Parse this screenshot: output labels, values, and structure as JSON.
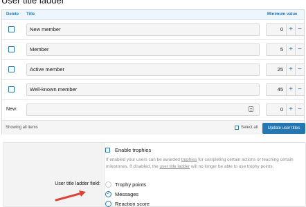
{
  "page": {
    "title": "User title ladder"
  },
  "table": {
    "headers": {
      "delete": "Delete",
      "title": "Title",
      "min_value": "Minimum value"
    },
    "rows": [
      {
        "title": "New member",
        "value": "0"
      },
      {
        "title": "Member",
        "value": "5"
      },
      {
        "title": "Active member",
        "value": "25"
      },
      {
        "title": "Well-known member",
        "value": "45"
      }
    ],
    "new_row": {
      "label": "New:",
      "title": "",
      "value": "0"
    },
    "plus_symbol": "+",
    "minus_symbol": "−"
  },
  "footer": {
    "status": "Showing all items",
    "select_all": "Select all",
    "update_button": "Update user titles"
  },
  "options": {
    "enable_trophies": "Enable trophies",
    "hint_part1": "If enabled your users can be awarded ",
    "hint_link1": "trophies",
    "hint_part2": " for completing certain actions or teaching certain milestones. If disabled, the ",
    "hint_link2": "user title ladder",
    "hint_part3": " will no longer be able to use trophy points.",
    "field_label": "User title ladder field:",
    "radio_options": [
      "Trophy points",
      "Messages",
      "Reaction score"
    ],
    "selected": "Messages"
  },
  "colors": {
    "accent": "#2577b1",
    "header_bg": "#edf6fd",
    "arrow": "#e0403a"
  }
}
